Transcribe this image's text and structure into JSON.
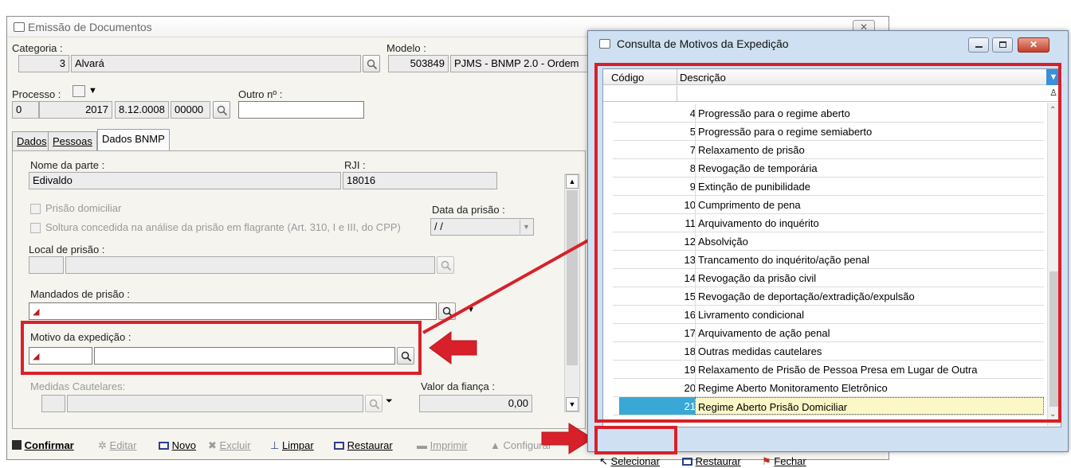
{
  "main": {
    "title": "Emissão de Documentos",
    "categoria": {
      "label": "Categoria :",
      "code": "3",
      "name": "Alvará"
    },
    "modelo": {
      "label": "Modelo :",
      "code": "503849",
      "name": "PJMS - BNMP 2.0 - Ordem"
    },
    "processo": {
      "label": "Processo :",
      "f1": "0",
      "f2": "2017",
      "f3": "8.12.0008",
      "f4": "00000"
    },
    "outro": {
      "label": "Outro nº :"
    },
    "tabs": [
      {
        "label": "Dados"
      },
      {
        "label": "Pessoas"
      },
      {
        "label": "Dados BNMP"
      }
    ],
    "nome_parte": {
      "label": "Nome da parte :",
      "value": "Edivaldo"
    },
    "rji": {
      "label": "RJI :",
      "value": "18016"
    },
    "prisao_domiciliar": "Prisão domiciliar",
    "soltura": "Soltura concedida na análise da prisão em flagrante (Art. 310, I e III, do CPP)",
    "data_prisao": {
      "label": "Data da prisão :",
      "value": "/ /"
    },
    "local_prisao": {
      "label": "Local de prisão :"
    },
    "mandados": {
      "label": "Mandados de prisão :"
    },
    "motivo": {
      "label": "Motivo da expedição :"
    },
    "medidas": {
      "label": "Medidas Cautelares:"
    },
    "fianca": {
      "label": "Valor da fiança :",
      "value": "0,00"
    },
    "toolbar": [
      {
        "label": "Confirmar",
        "icon": "save-icon"
      },
      {
        "label": "Editar",
        "icon": "edit-icon"
      },
      {
        "label": "Novo",
        "icon": "new-icon"
      },
      {
        "label": "Excluir",
        "icon": "delete-icon"
      },
      {
        "label": "Limpar",
        "icon": "clear-icon"
      },
      {
        "label": "Restaurar",
        "icon": "restore-icon"
      },
      {
        "label": "Imprimir",
        "icon": "print-icon"
      },
      {
        "label": "Configurar",
        "icon": "config-icon"
      }
    ]
  },
  "modal": {
    "title": "Consulta de Motivos da Expedição",
    "col_codigo": "Código",
    "col_descricao": "Descrição",
    "rows": [
      {
        "code": "4",
        "desc": "Progressão para o regime aberto"
      },
      {
        "code": "5",
        "desc": "Progressão para o regime semiaberto"
      },
      {
        "code": "7",
        "desc": "Relaxamento de prisão"
      },
      {
        "code": "8",
        "desc": "Revogação de temporária"
      },
      {
        "code": "9",
        "desc": "Extinção de punibilidade"
      },
      {
        "code": "10",
        "desc": "Cumprimento de pena"
      },
      {
        "code": "11",
        "desc": "Arquivamento do inquérito"
      },
      {
        "code": "12",
        "desc": "Absolvição"
      },
      {
        "code": "13",
        "desc": "Trancamento do inquérito/ação penal"
      },
      {
        "code": "14",
        "desc": "Revogação da prisão civil"
      },
      {
        "code": "15",
        "desc": "Revogação de deportação/extradição/expulsão"
      },
      {
        "code": "16",
        "desc": "Livramento condicional"
      },
      {
        "code": "17",
        "desc": "Arquivamento de ação penal"
      },
      {
        "code": "18",
        "desc": "Outras medidas cautelares"
      },
      {
        "code": "19",
        "desc": "Relaxamento de Prisão de Pessoa Presa em Lugar de Outra"
      },
      {
        "code": "20",
        "desc": "Regime Aberto Monitoramento Eletrônico"
      },
      {
        "code": "21",
        "desc": "Regime Aberto Prisão Domiciliar"
      }
    ],
    "selected_code": "21",
    "buttons": {
      "select": "Selecionar",
      "restore": "Restaurar",
      "close": "Fechar"
    }
  },
  "colors": {
    "highlight": "#d8202a",
    "selection": "#39a8d6",
    "selected_row_bg": "#fbf7c7"
  }
}
